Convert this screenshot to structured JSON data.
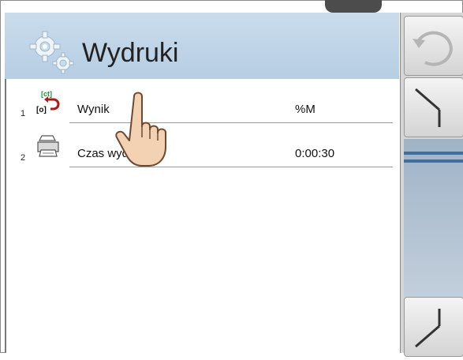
{
  "header": {
    "title": "Wydruki"
  },
  "rows": [
    {
      "number": "1",
      "label": "Wynik",
      "value": "%M",
      "icon": "result-print-icon"
    },
    {
      "number": "2",
      "label": "Czas wydr",
      "value": "0:00:30",
      "icon": "printer-icon"
    }
  ],
  "sidebar": {
    "buttons": [
      {
        "name": "back-button",
        "icon": "undo-arrow-icon"
      },
      {
        "name": "scroll-up-button",
        "icon": "scroll-up-icon"
      },
      {
        "name": "scroll-down-button",
        "icon": "scroll-down-icon"
      }
    ]
  },
  "colors": {
    "title_bar": "#c2d6e8",
    "accent": "#3f6f9a"
  }
}
